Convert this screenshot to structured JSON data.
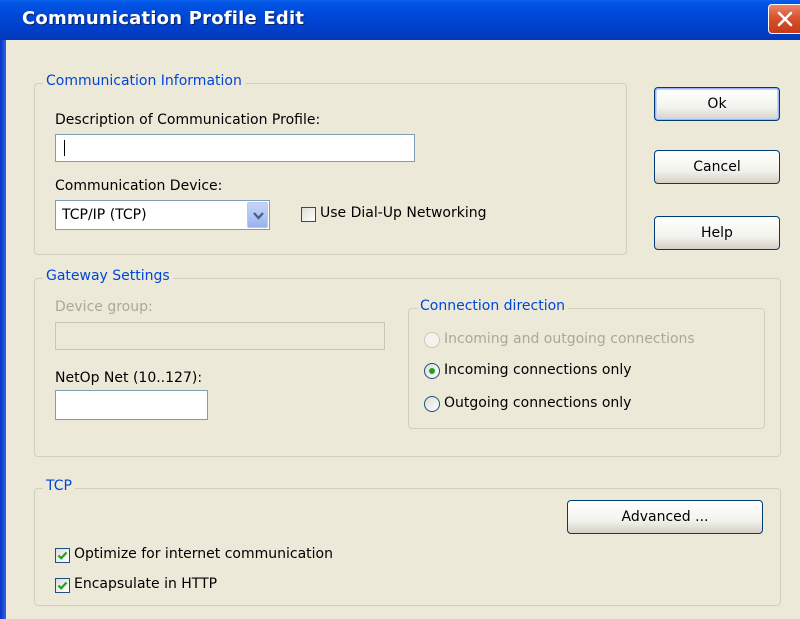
{
  "window": {
    "title": "Communication Profile Edit"
  },
  "communication_information": {
    "legend": "Communication Information",
    "description_label": "Description of Communication Profile:",
    "description_value": "",
    "device_label": "Communication Device:",
    "device_selected": "TCP/IP (TCP)",
    "dialup_label": "Use Dial-Up Networking",
    "dialup_checked": false
  },
  "buttons": {
    "ok": "Ok",
    "cancel": "Cancel",
    "help": "Help",
    "advanced": "Advanced ..."
  },
  "gateway_settings": {
    "legend": "Gateway Settings",
    "device_group_label": "Device group:",
    "device_group_value": "",
    "netop_net_label": "NetOp Net (10..127):",
    "netop_net_value": "",
    "connection_direction": {
      "legend": "Connection direction",
      "options": [
        {
          "label": "Incoming and outgoing connections",
          "selected": false,
          "enabled": false
        },
        {
          "label": "Incoming connections only",
          "selected": true,
          "enabled": true
        },
        {
          "label": "Outgoing connections only",
          "selected": false,
          "enabled": true
        }
      ]
    }
  },
  "tcp": {
    "legend": "TCP",
    "optimize_label": "Optimize for internet communication",
    "optimize_checked": true,
    "encapsulate_label": "Encapsulate in HTTP",
    "encapsulate_checked": true
  },
  "icons": {
    "close": "close-icon",
    "dropdown": "chevron-down-icon",
    "check": "checkmark-icon"
  },
  "colors": {
    "titlebar": "#0047D6",
    "group_legend": "#0046D5",
    "dialog_bg": "#ECE9D8",
    "check_green": "#21A121"
  }
}
